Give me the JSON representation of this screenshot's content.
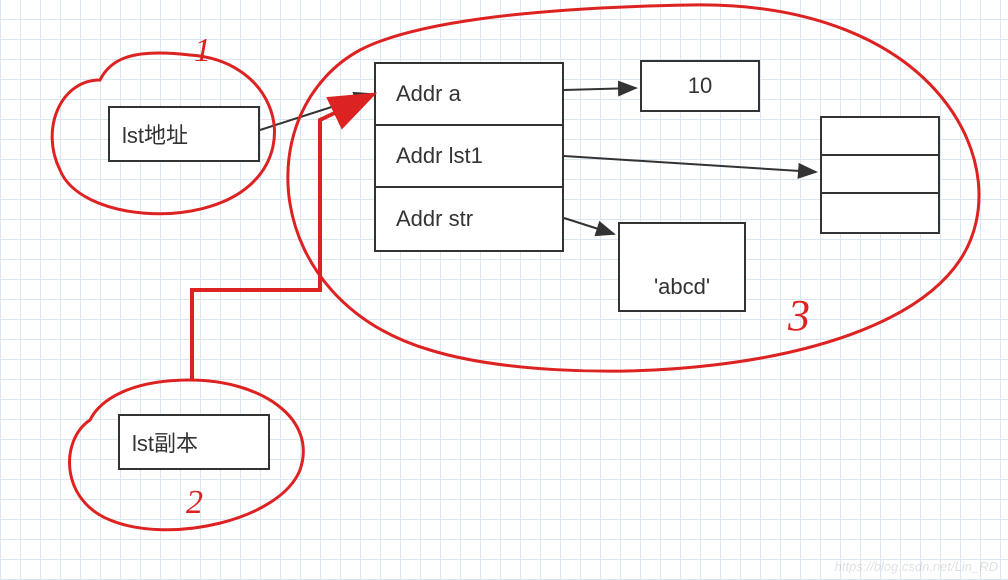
{
  "diagram": {
    "left_box_1": "lst地址",
    "left_box_2": "lst副本",
    "addr_cells": {
      "a": "Addr a",
      "lst1": "Addr lst1",
      "str": "Addr str"
    },
    "value_box_10": "10",
    "value_box_abcd": "'abcd'"
  },
  "annotations": {
    "ann1": "1",
    "ann2": "2",
    "ann3": "3"
  },
  "watermark": "https://blog.csdn.net/Lin_RD"
}
